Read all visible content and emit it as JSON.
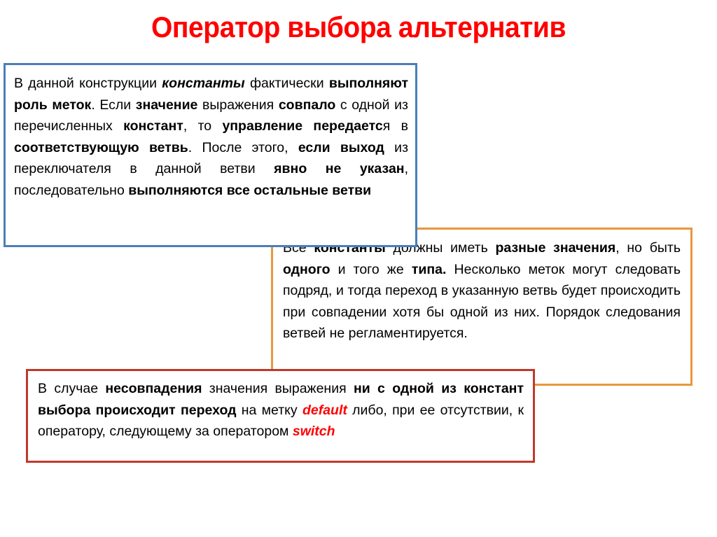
{
  "slide": {
    "title": "Оператор выбора альтернатив",
    "title_color": "#ff0000",
    "background_color": "#ffffff"
  },
  "boxes": [
    {
      "id": "box-blue",
      "name": "info-box-constants-as-labels",
      "border_color": "#4a7ebb",
      "plain_text": "В данной конструкции константы фактически выполняют роль меток. Если значение выражения совпало с одной из перечисленных констант, то управление передается в соответствующую ветвь. После этого, если выход из переключателя в данной ветви явно не указан, последовательно выполняются все остальные ветви",
      "lines": [
        {
          "segments": [
            {
              "text": "В данной конструкции ",
              "style": "normal"
            },
            {
              "text": "константы",
              "style": "bold-italic"
            },
            {
              "text": " фактически ",
              "style": "normal"
            },
            {
              "text": "выполняют роль меток",
              "style": "bold"
            },
            {
              "text": ". Если ",
              "style": "normal"
            },
            {
              "text": "значение",
              "style": "bold"
            },
            {
              "text": " выражения ",
              "style": "normal"
            },
            {
              "text": "совпало",
              "style": "bold"
            },
            {
              "text": " с одной из перечисленных ",
              "style": "normal"
            },
            {
              "text": "констант",
              "style": "bold"
            },
            {
              "text": ", то ",
              "style": "normal"
            },
            {
              "text": "управление передаетс",
              "style": "bold"
            },
            {
              "text": "я в ",
              "style": "normal"
            },
            {
              "text": "соответствующую ветвь",
              "style": "bold"
            },
            {
              "text": ". После этого, ",
              "style": "normal"
            },
            {
              "text": "если выход",
              "style": "bold"
            },
            {
              "text": " из переключателя в данной ветви ",
              "style": "normal"
            },
            {
              "text": "явно не указан",
              "style": "bold"
            },
            {
              "text": ", последовательно ",
              "style": "normal"
            },
            {
              "text": "выполняются все остальные ветви",
              "style": "bold"
            }
          ]
        }
      ]
    },
    {
      "id": "box-orange",
      "name": "info-box-constant-value-rules",
      "border_color": "#e8973c",
      "plain_text": "Все константы должны иметь разные значения, но быть одного и того же типа. Несколько меток могут следовать подряд, и тогда переход в указанную ветвь будет происходить при совпадении хотя бы одной из них. Порядок следования ветвей не регламентируется.",
      "lines": [
        {
          "segments": [
            {
              "text": "Все ",
              "style": "normal"
            },
            {
              "text": "константы",
              "style": "bold"
            },
            {
              "text": " должны иметь ",
              "style": "normal"
            },
            {
              "text": "разные значения",
              "style": "bold"
            },
            {
              "text": ", но быть ",
              "style": "normal"
            },
            {
              "text": "одного",
              "style": "bold"
            },
            {
              "text": " и того же ",
              "style": "normal"
            },
            {
              "text": "типа.",
              "style": "bold"
            },
            {
              "text": " Несколько меток могут следовать подряд, и тогда переход в указанную ветвь будет происходить при совпадении хотя бы одной из них. Порядок следования ветвей не регламентируется.",
              "style": "normal"
            }
          ]
        }
      ]
    },
    {
      "id": "box-red",
      "name": "info-box-default-branch",
      "border_color": "#c0392b",
      "plain_text": "В случае несовпадения значения выражения ни с одной из констант выбора происходит переход на метку default либо, при ее отсутствии, к оператору, следующему за оператором switch",
      "lines": [
        {
          "segments": [
            {
              "text": "В случае ",
              "style": "normal"
            },
            {
              "text": "несовпадения",
              "style": "bold"
            },
            {
              "text": " значения выражения ",
              "style": "normal"
            },
            {
              "text": "ни с одной из констант выбора происходит переход",
              "style": "bold"
            },
            {
              "text": " на метку ",
              "style": "normal"
            },
            {
              "text": "default",
              "style": "red-bold-italic"
            },
            {
              "text": " либо, при ее отсутствии, к оператору, следующему за оператором ",
              "style": "normal"
            },
            {
              "text": "switch",
              "style": "red-bold-italic"
            }
          ]
        }
      ]
    }
  ]
}
